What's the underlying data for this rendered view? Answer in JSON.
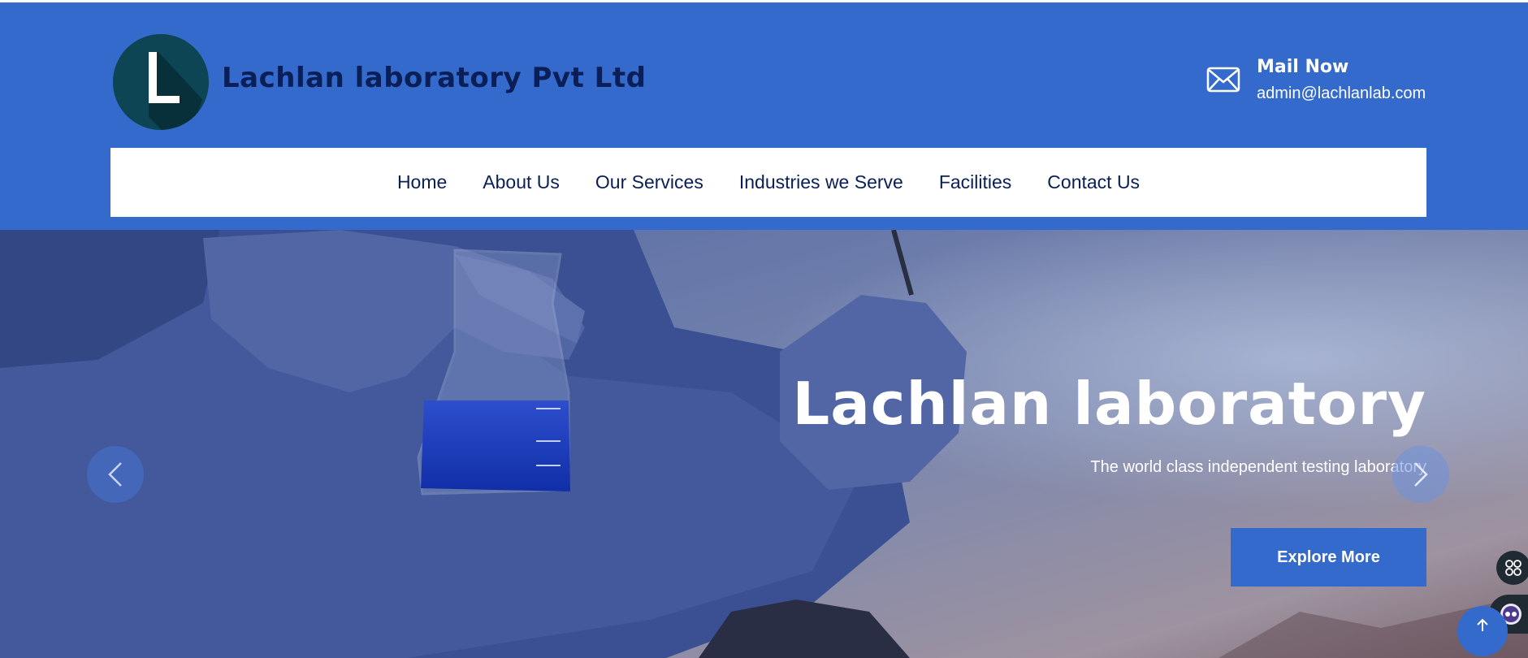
{
  "brand": {
    "logo_letter": "L",
    "name": "Lachlan laboratory Pvt Ltd"
  },
  "contact": {
    "title": "Mail Now",
    "email": "admin@lachlanlab.com",
    "icon": "mail-icon"
  },
  "nav": {
    "items": [
      {
        "label": "Home"
      },
      {
        "label": "About Us"
      },
      {
        "label": "Our Services"
      },
      {
        "label": "Industries we Serve"
      },
      {
        "label": "Facilities"
      },
      {
        "label": "Contact Us"
      }
    ]
  },
  "hero": {
    "title": "Lachlan laboratory",
    "subtitle": "The world class independent testing laboratory",
    "button_label": "Explore More"
  },
  "colors": {
    "primary": "#346acb",
    "dark_navy": "#0a1f57",
    "logo_teal": "#0d4554"
  }
}
